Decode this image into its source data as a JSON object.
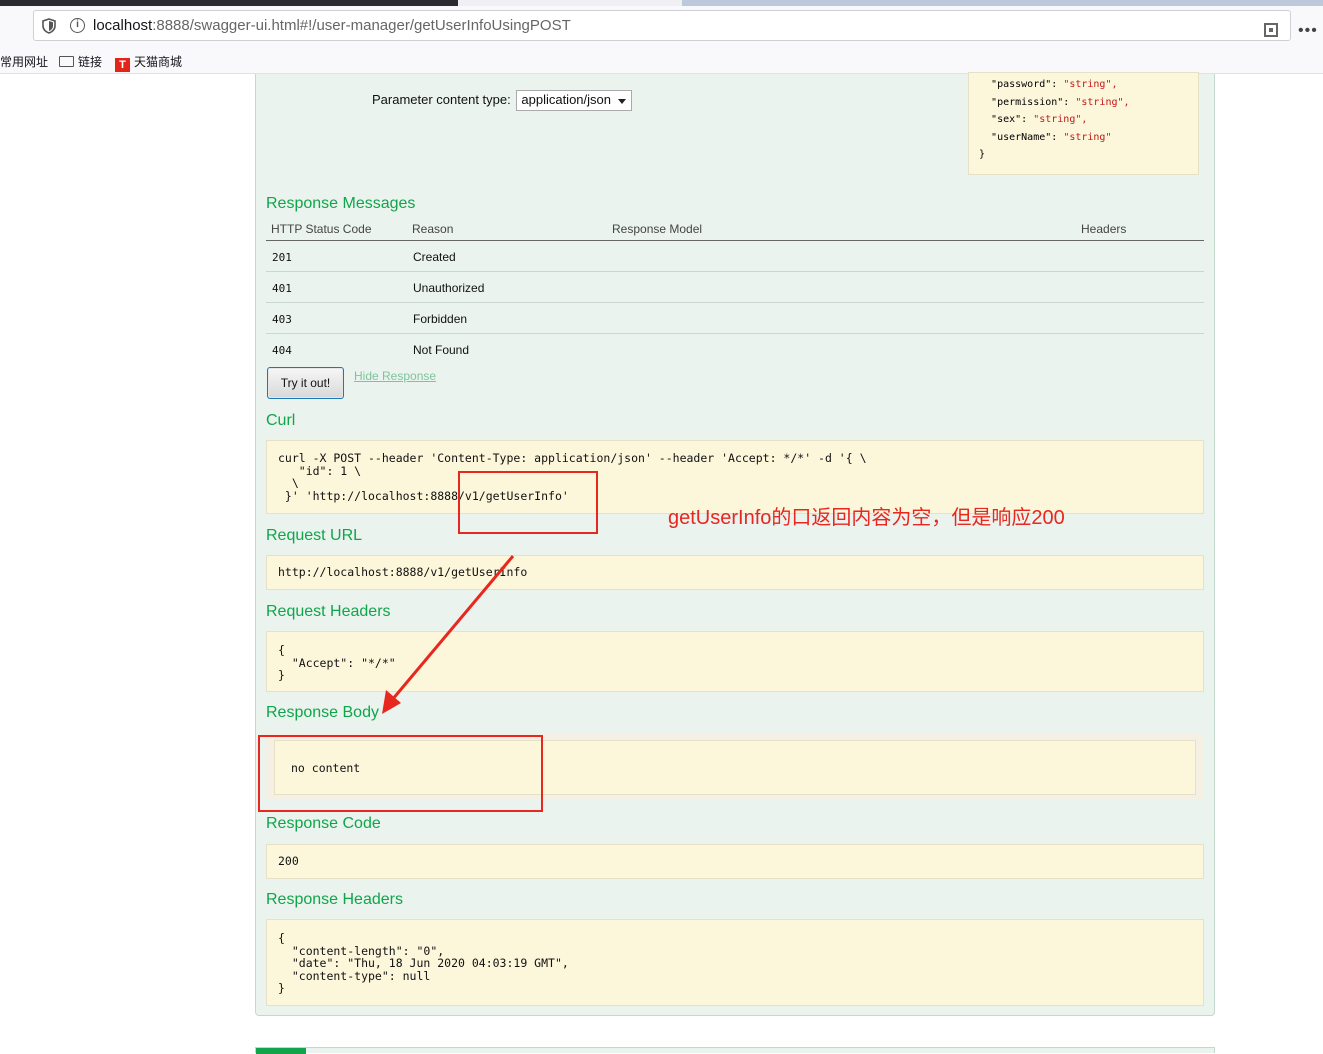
{
  "browser": {
    "url_host": "localhost",
    "url_rest": ":8888/swagger-ui.html#!/user-manager/getUserInfoUsingPOST",
    "bookmarks": [
      "常用网址",
      "链接",
      "天猫商城"
    ],
    "tmall_badge": "T",
    "info_glyph": "i",
    "menu_glyph": "•••"
  },
  "params": {
    "content_type_label": "Parameter content type:",
    "content_type_value": "application/json",
    "sample_lines": [
      {
        "key": "\"password\"",
        "val": "\"string\","
      },
      {
        "key": "\"permission\"",
        "val": "\"string\","
      },
      {
        "key": "\"sex\"",
        "val": "\"string\","
      },
      {
        "key": "\"userName\"",
        "val": "\"string\""
      }
    ],
    "sample_close": "}"
  },
  "response_messages": {
    "title": "Response Messages",
    "headers": [
      "HTTP Status Code",
      "Reason",
      "Response Model",
      "Headers"
    ],
    "rows": [
      {
        "code": "201",
        "reason": "Created"
      },
      {
        "code": "401",
        "reason": "Unauthorized"
      },
      {
        "code": "403",
        "reason": "Forbidden"
      },
      {
        "code": "404",
        "reason": "Not Found"
      }
    ]
  },
  "actions": {
    "try_label": "Try it out!",
    "hide_label": "Hide Response"
  },
  "curl": {
    "title": "Curl",
    "text": "curl -X POST --header 'Content-Type: application/json' --header 'Accept: */*' -d '{ \\\n   \"id\": 1 \\\n  \\\n }' 'http://localhost:8888/v1/getUserInfo'"
  },
  "request_url": {
    "title": "Request URL",
    "text": "http://localhost:8888/v1/getUserInfo"
  },
  "request_headers": {
    "title": "Request Headers",
    "text": "{\n  \"Accept\": \"*/*\"\n}"
  },
  "response_body": {
    "title": "Response Body",
    "text": "no content"
  },
  "response_code": {
    "title": "Response Code",
    "text": "200"
  },
  "response_headers": {
    "title": "Response Headers",
    "text": "{\n  \"content-length\": \"0\",\n  \"date\": \"Thu, 18 Jun 2020 04:03:19 GMT\",\n  \"content-type\": null\n}"
  },
  "annotation": {
    "text": "getUserInfo的口返回内容为空，但是响应200",
    "color": "#e8271e"
  }
}
